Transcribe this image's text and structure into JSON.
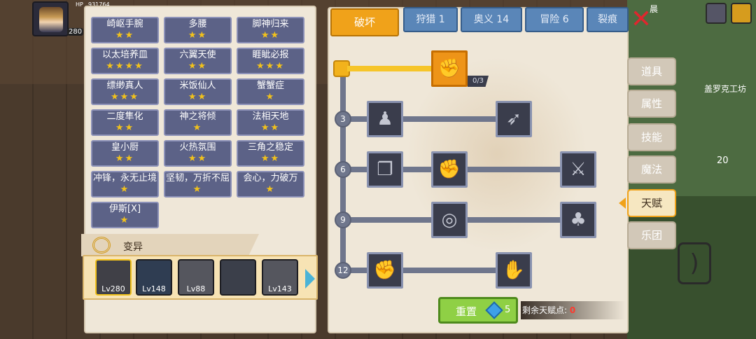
{
  "hud": {
    "hp_label": "HP",
    "hp_value": "931764",
    "level_badge": "280"
  },
  "skills": [
    {
      "name": "崎岖手腕",
      "stars": "★★"
    },
    {
      "name": "多腰",
      "stars": "★★"
    },
    {
      "name": "脚神归来",
      "stars": "★★"
    },
    {
      "name": "以太培养皿",
      "stars": "★★★★"
    },
    {
      "name": "六翼天使",
      "stars": "★★"
    },
    {
      "name": "睚眦必报",
      "stars": "★★★"
    },
    {
      "name": "缥缈真人",
      "stars": "★★★"
    },
    {
      "name": "米饭仙人",
      "stars": "★★"
    },
    {
      "name": "蟹蟹症",
      "stars": "★"
    },
    {
      "name": "二度隼化",
      "stars": "★★"
    },
    {
      "name": "神之将倾",
      "stars": "★"
    },
    {
      "name": "法相天地",
      "stars": "★★"
    },
    {
      "name": "皇小厨",
      "stars": "★★"
    },
    {
      "name": "火热氛围",
      "stars": "★★"
    },
    {
      "name": "三角之稳定",
      "stars": "★★"
    },
    {
      "name": "冲锋，永无止境",
      "stars": "★"
    },
    {
      "name": "坚韧，万折不屈",
      "stars": "★"
    },
    {
      "name": "会心，力破万",
      "stars": "★"
    },
    {
      "name": "伊斯[X]",
      "stars": "★"
    }
  ],
  "mutation_label": "变异",
  "heroes": [
    {
      "level": "Lv280",
      "selected": true
    },
    {
      "level": "Lv148",
      "selected": false
    },
    {
      "level": "Lv88",
      "selected": false
    },
    {
      "level": "",
      "selected": false
    },
    {
      "level": "Lv143",
      "selected": false
    }
  ],
  "tabs": {
    "active": "破坏",
    "others": [
      "狩猎 1",
      "奥义 14",
      "冒险 6",
      "裂痕"
    ]
  },
  "top_right_text": "晨",
  "tree": {
    "levels": [
      "3",
      "6",
      "9",
      "12"
    ],
    "top_node_count": "0/3"
  },
  "reset": {
    "label": "重置",
    "cost": "5"
  },
  "remaining": {
    "label": "剩余天赋点:",
    "value": "0"
  },
  "side_menu": [
    "道具",
    "属性",
    "技能",
    "魔法",
    "天赋",
    "乐团"
  ],
  "side_active": "天赋",
  "shop_sign": "盖罗克工坊",
  "item_count": "20",
  "icons": {
    "close": "close-x-icon",
    "gem": "diamond-gem-icon",
    "mutation": "dna-helix-icon",
    "bow": "bow-icon"
  }
}
